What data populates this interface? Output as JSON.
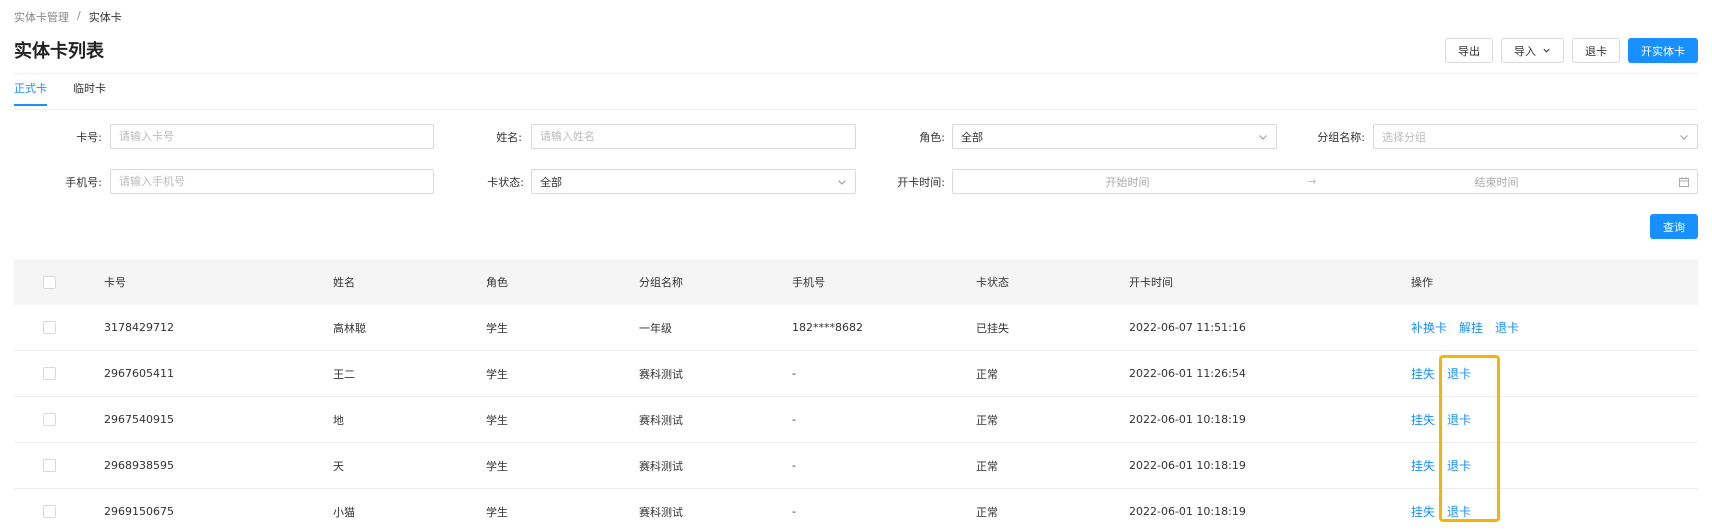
{
  "breadcrumb": {
    "parent": "实体卡管理",
    "separator": "/",
    "current": "实体卡"
  },
  "page_title": "实体卡列表",
  "actions": {
    "export": "导出",
    "import": "导入",
    "return_card": "退卡",
    "open_card": "开实体卡"
  },
  "tabs": [
    "正式卡",
    "临时卡"
  ],
  "filters": {
    "card_no": {
      "label": "卡号:",
      "placeholder": "请输入卡号"
    },
    "name": {
      "label": "姓名:",
      "placeholder": "请输入姓名"
    },
    "role": {
      "label": "角色:",
      "value": "全部"
    },
    "group": {
      "label": "分组名称:",
      "placeholder": "选择分组"
    },
    "phone": {
      "label": "手机号:",
      "placeholder": "请输入手机号"
    },
    "status": {
      "label": "卡状态:",
      "value": "全部"
    },
    "open_time": {
      "label": "开卡时间:",
      "start": "开始时间",
      "arrow": "→",
      "end": "结束时间"
    },
    "query": "查询"
  },
  "table": {
    "headers": [
      "卡号",
      "姓名",
      "角色",
      "分组名称",
      "手机号",
      "卡状态",
      "开卡时间",
      "操作"
    ],
    "rows": [
      {
        "card_no": "3178429712",
        "name": "高林聪",
        "role": "学生",
        "group": "一年级",
        "phone": "182****8682",
        "status": "已挂失",
        "time": "2022-06-07 11:51:16",
        "ops": [
          "补换卡",
          "解挂",
          "退卡"
        ]
      },
      {
        "card_no": "2967605411",
        "name": "王二",
        "role": "学生",
        "group": "赛科测试",
        "phone": "-",
        "status": "正常",
        "time": "2022-06-01 11:26:54",
        "ops": [
          "挂失",
          "退卡"
        ]
      },
      {
        "card_no": "2967540915",
        "name": "地",
        "role": "学生",
        "group": "赛科测试",
        "phone": "-",
        "status": "正常",
        "time": "2022-06-01 10:18:19",
        "ops": [
          "挂失",
          "退卡"
        ]
      },
      {
        "card_no": "2968938595",
        "name": "天",
        "role": "学生",
        "group": "赛科测试",
        "phone": "-",
        "status": "正常",
        "time": "2022-06-01 10:18:19",
        "ops": [
          "挂失",
          "退卡"
        ]
      },
      {
        "card_no": "2969150675",
        "name": "小猫",
        "role": "学生",
        "group": "赛科测试",
        "phone": "-",
        "status": "正常",
        "time": "2022-06-01 10:18:19",
        "ops": [
          "挂失",
          "退卡"
        ]
      }
    ]
  },
  "colors": {
    "primary": "#1890ff",
    "highlight": "#f5b400"
  }
}
